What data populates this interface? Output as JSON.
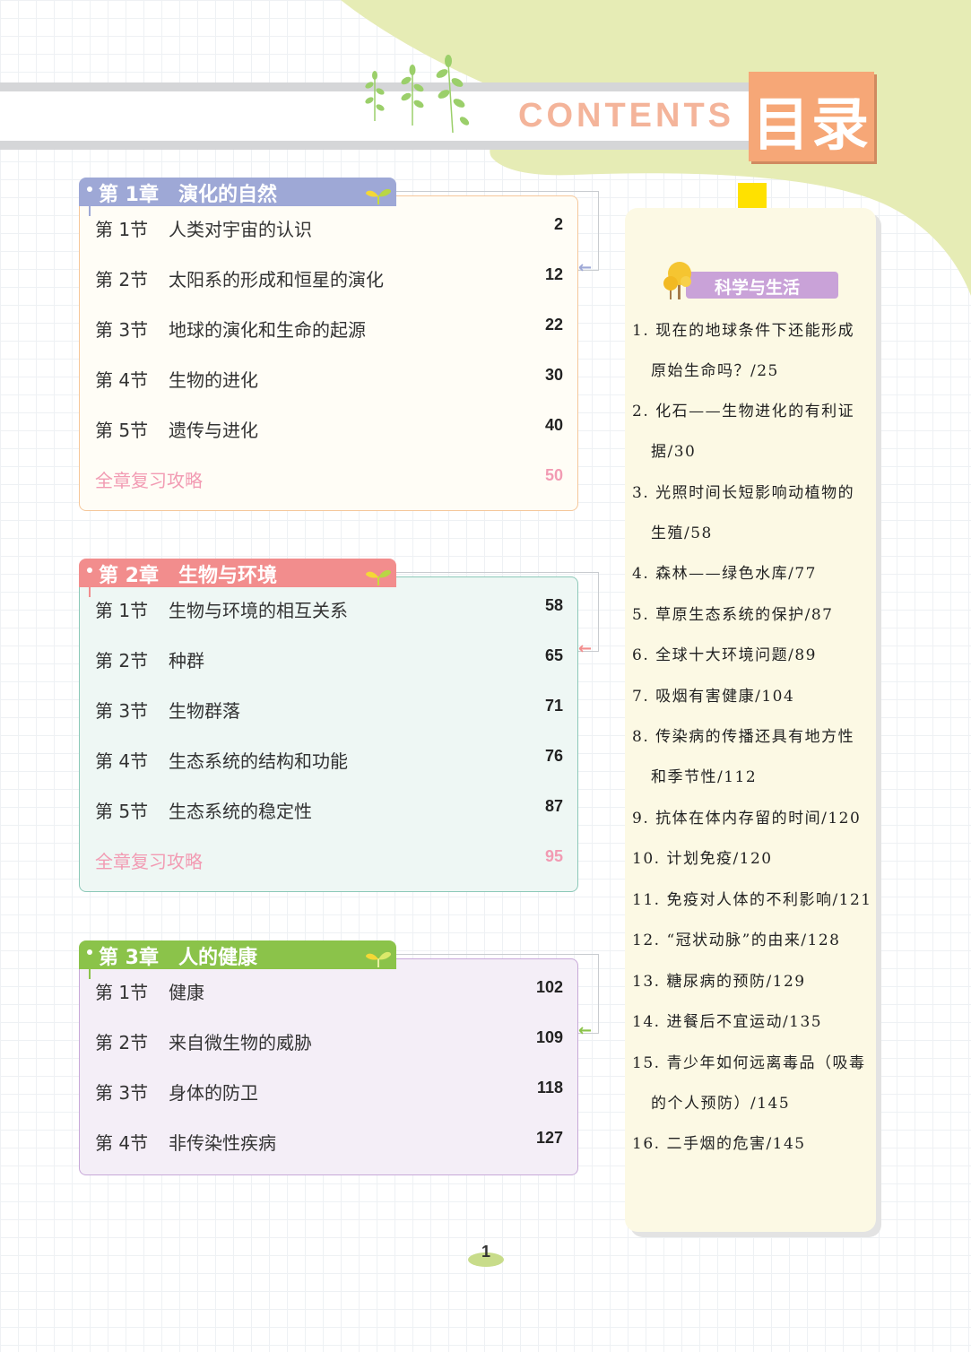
{
  "header": {
    "contents_word": "CONTENTS",
    "mulu": "目录"
  },
  "colors": {
    "ch1": "#9ea8d6",
    "ch1_box_border": "#f5c79a",
    "ch1_box_bg": "#fffdf6",
    "ch2": "#f28d8d",
    "ch2_box_border": "#8cc8b8",
    "ch2_box_bg": "#eef7f4",
    "ch3": "#8bc34a",
    "ch3_box_border": "#c7a8d8",
    "ch3_box_bg": "#f4eef7",
    "review": "#f29bb3",
    "sidebar_bg": "#fcf9e4",
    "sidebar_badge": "#c9a2d8"
  },
  "chapters": [
    {
      "title": "第 1章　演化的自然",
      "sections": [
        {
          "num": "第 1节",
          "name": "人类对宇宙的认识",
          "page": "2"
        },
        {
          "num": "第 2节",
          "name": "太阳系的形成和恒星的演化",
          "page": "12"
        },
        {
          "num": "第 3节",
          "name": "地球的演化和生命的起源",
          "page": "22"
        },
        {
          "num": "第 4节",
          "name": "生物的进化",
          "page": "30"
        },
        {
          "num": "第 5节",
          "name": "遗传与进化",
          "page": "40"
        }
      ],
      "review": {
        "label": "全章复习攻略",
        "page": "50"
      }
    },
    {
      "title": "第 2章　生物与环境",
      "sections": [
        {
          "num": "第 1节",
          "name": "生物与环境的相互关系",
          "page": "58"
        },
        {
          "num": "第 2节",
          "name": "种群",
          "page": "65"
        },
        {
          "num": "第 3节",
          "name": "生物群落",
          "page": "71"
        },
        {
          "num": "第 4节",
          "name": "生态系统的结构和功能",
          "page": "76"
        },
        {
          "num": "第 5节",
          "name": "生态系统的稳定性",
          "page": "87"
        }
      ],
      "review": {
        "label": "全章复习攻略",
        "page": "95"
      }
    },
    {
      "title": "第 3章　人的健康",
      "sections": [
        {
          "num": "第 1节",
          "name": "健康",
          "page": "102"
        },
        {
          "num": "第 2节",
          "name": "来自微生物的威胁",
          "page": "109"
        },
        {
          "num": "第 3节",
          "name": "身体的防卫",
          "page": "118"
        },
        {
          "num": "第 4节",
          "name": "非传染性疾病",
          "page": "127"
        }
      ]
    }
  ],
  "sidebar": {
    "badge": "科学与生活",
    "items": [
      {
        "line1": "1. 现在的地球条件下还能形成",
        "line2": "原始生命吗？/25"
      },
      {
        "line1": "2. 化石——生物进化的有利证",
        "line2": "据/30"
      },
      {
        "line1": "3. 光照时间长短影响动植物的",
        "line2": "生殖/58"
      },
      {
        "line1": "4. 森林——绿色水库/77"
      },
      {
        "line1": "5. 草原生态系统的保护/87"
      },
      {
        "line1": "6. 全球十大环境问题/89"
      },
      {
        "line1": "7. 吸烟有害健康/104"
      },
      {
        "line1": "8. 传染病的传播还具有地方性",
        "line2": "和季节性/112"
      },
      {
        "line1": "9. 抗体在体内存留的时间/120"
      },
      {
        "line1": "10. 计划免疫/120"
      },
      {
        "line1": "11. 免疫对人体的不利影响/121"
      },
      {
        "line1": "12. “冠状动脉”的由来/128"
      },
      {
        "line1": "13. 糖尿病的预防/129"
      },
      {
        "line1": "14. 进餐后不宜运动/135"
      },
      {
        "line1": "15. 青少年如何远离毒品（吸毒",
        "line2": "的个人预防）/145"
      },
      {
        "line1": "16. 二手烟的危害/145"
      }
    ]
  },
  "footer": {
    "page_number": "1"
  }
}
